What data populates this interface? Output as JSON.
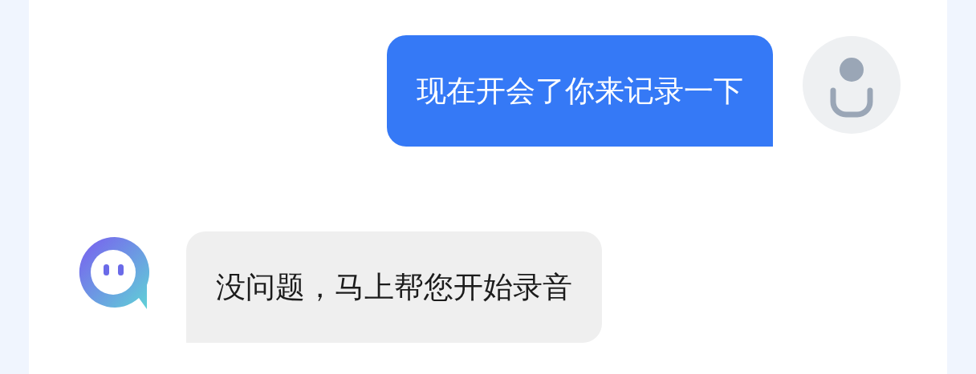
{
  "messages": [
    {
      "kind": "outgoing",
      "text": "现在开会了你来记录一下"
    },
    {
      "kind": "incoming",
      "text": "没问题，马上帮您开始录音"
    }
  ]
}
